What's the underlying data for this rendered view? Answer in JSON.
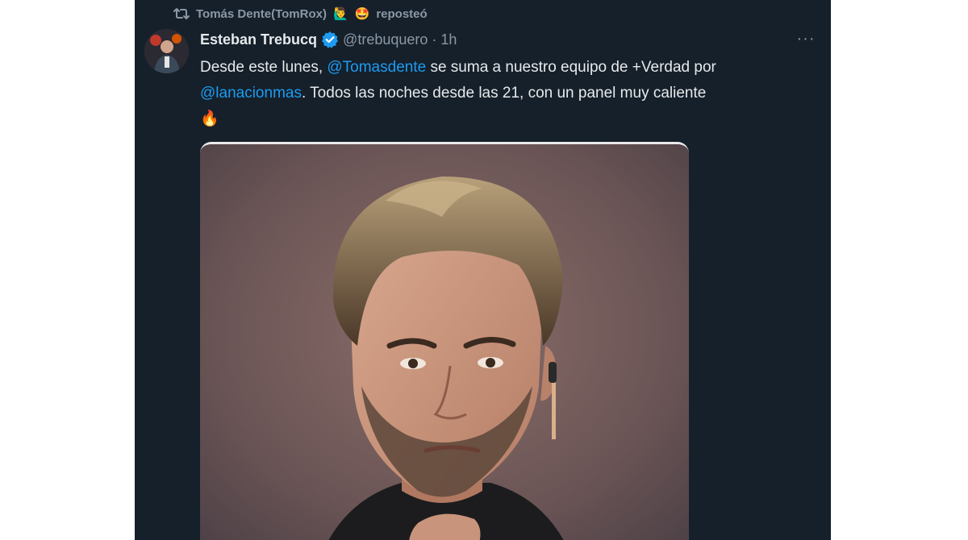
{
  "repost": {
    "user_name": "Tomás Dente(TomRox)",
    "emoji_1": "🙋‍♂️",
    "emoji_2": "🤩",
    "action_label": "reposteó"
  },
  "tweet": {
    "author_name": "Esteban Trebucq",
    "handle": "@trebuquero",
    "separator": "·",
    "time": "1h",
    "more_label": "···",
    "text_part_1": "Desde este lunes, ",
    "mention_1": "@Tomasdente",
    "text_part_2": " se suma a nuestro equipo de +Verdad por ",
    "mention_2": "@lanacionmas",
    "text_part_3": ". Todos las noches desde las 21, con un panel muy caliente",
    "emoji_fire": "🔥"
  },
  "colors": {
    "background": "#15202b",
    "text_primary": "#e7e9ea",
    "text_secondary": "#8b98a5",
    "link": "#1d9bf0",
    "verified": "#1d9bf0"
  },
  "icons": {
    "repost": "repost-icon",
    "verified": "verified-badge-icon",
    "more": "more-options-icon"
  }
}
